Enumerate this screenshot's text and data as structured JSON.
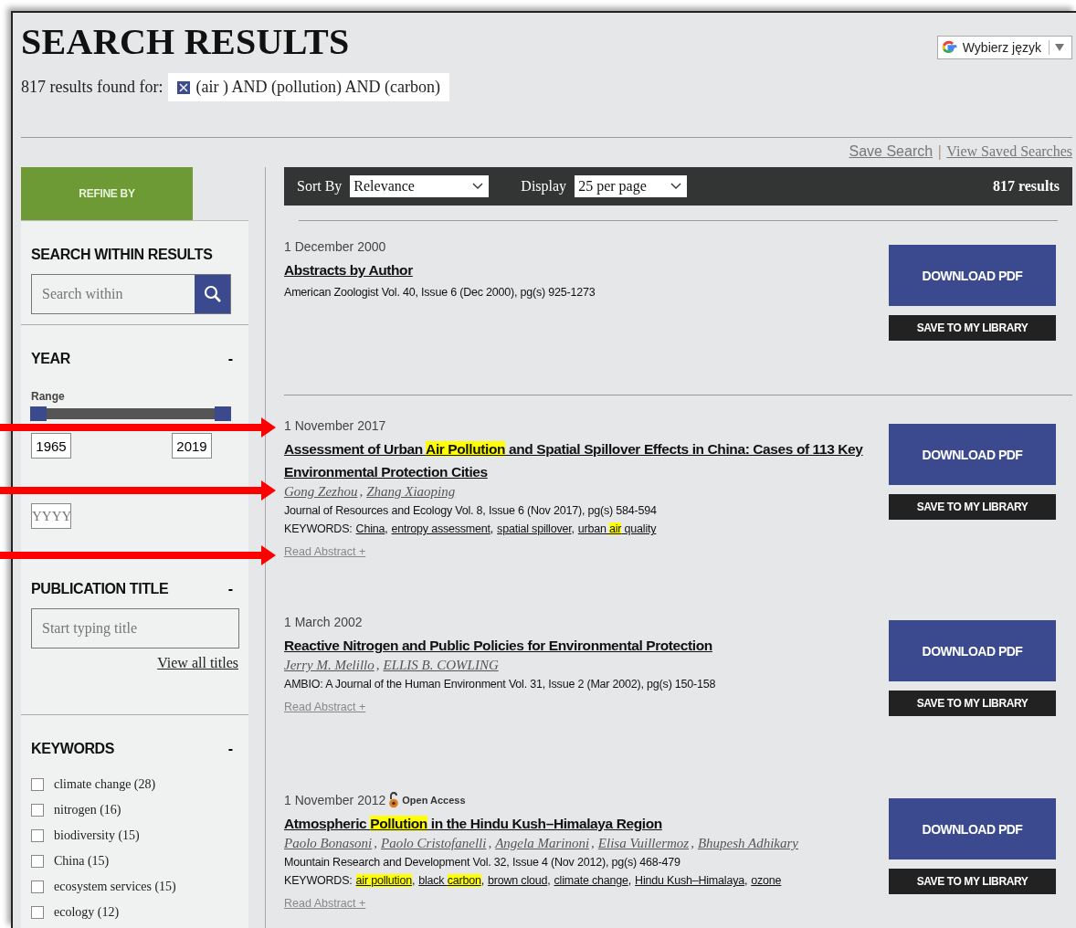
{
  "header": {
    "title": "SEARCH RESULTS",
    "results_label": "817 results found for:",
    "query": "(air ) AND (pollution) AND (carbon)"
  },
  "language": {
    "label": "Wybierz język"
  },
  "saved": {
    "save": "Save Search",
    "separator": "|",
    "view": "View Saved Searches"
  },
  "sidebar": {
    "refine": "REFINE BY",
    "search_within": {
      "heading": "SEARCH WITHIN RESULTS",
      "placeholder": "Search within"
    },
    "year": {
      "heading": "YEAR",
      "toggle": "-",
      "range_label": "Range",
      "from": "1965",
      "to": "2019",
      "single_placeholder": "YYYY"
    },
    "publication": {
      "heading": "PUBLICATION TITLE",
      "toggle": "-",
      "placeholder": "Start typing title",
      "link": "View all titles"
    },
    "keywords": {
      "heading": "KEYWORDS",
      "toggle": "-",
      "items": [
        {
          "label": "climate change (28)",
          "checked": false
        },
        {
          "label": "nitrogen (16)",
          "checked": false
        },
        {
          "label": "biodiversity (15)",
          "checked": false
        },
        {
          "label": "China (15)",
          "checked": false
        },
        {
          "label": "ecosystem services (15)",
          "checked": false
        },
        {
          "label": "ecology (12)",
          "checked": false
        }
      ]
    }
  },
  "toolbar": {
    "sort_label": "Sort By",
    "sort_value": "Relevance",
    "display_label": "Display",
    "display_value": "25 per page",
    "count": "817 results"
  },
  "separators": {
    "author": ",",
    "keyword": ","
  },
  "results": [
    {
      "date": "1 December 2000",
      "open_access": false,
      "title": [
        {
          "text": "Abstracts by Author",
          "highlight": false
        }
      ],
      "source": "American Zoologist Vol. 40, Issue 6 (Dec 2000), pg(s) 925-1273",
      "download": "DOWNLOAD PDF",
      "save": "SAVE TO MY LIBRARY"
    },
    {
      "date": "1 November 2017",
      "open_access": false,
      "title": [
        {
          "text": "Assessment of Urban ",
          "highlight": false
        },
        {
          "text": "Air Pollution",
          "highlight": true
        },
        {
          "text": " and Spatial Spillover Effects in China: Cases of 113 Key Environmental Protection Cities",
          "highlight": false
        }
      ],
      "authors": [
        "Gong Zezhou",
        "Zhang Xiaoping"
      ],
      "source": "Journal of Resources and Ecology Vol. 8, Issue 6 (Nov 2017), pg(s) 584-594",
      "keywords_label": "KEYWORDS:",
      "keywords": [
        [
          {
            "text": "China",
            "highlight": false
          }
        ],
        [
          {
            "text": "entropy assessment",
            "highlight": false
          }
        ],
        [
          {
            "text": "spatial spillover",
            "highlight": false
          }
        ],
        [
          {
            "text": "urban ",
            "highlight": false
          },
          {
            "text": "air",
            "highlight": true
          },
          {
            "text": " quality",
            "highlight": false
          }
        ]
      ],
      "read_abstract": "Read Abstract +",
      "download": "DOWNLOAD PDF",
      "save": "SAVE TO MY LIBRARY"
    },
    {
      "date": "1 March 2002",
      "open_access": false,
      "title": [
        {
          "text": "Reactive Nitrogen and Public Policies for Environmental Protection",
          "highlight": false
        }
      ],
      "authors": [
        "Jerry M. Melillo",
        "ELLIS B. COWLING"
      ],
      "source": "AMBIO: A Journal of the Human Environment Vol. 31, Issue 2 (Mar 2002), pg(s) 150-158",
      "read_abstract": "Read Abstract +",
      "download": "DOWNLOAD PDF",
      "save": "SAVE TO MY LIBRARY"
    },
    {
      "date": "1 November 2012",
      "open_access": true,
      "open_access_label": "Open Access",
      "title": [
        {
          "text": "Atmospheric ",
          "highlight": false
        },
        {
          "text": "Pollution",
          "highlight": true
        },
        {
          "text": " in the Hindu Kush–Himalaya Region",
          "highlight": false
        }
      ],
      "authors": [
        "Paolo Bonasoni",
        "Paolo Cristofanelli",
        "Angela Marinoni",
        "Elisa Vuillermoz",
        "Bhupesh Adhikary"
      ],
      "source": "Mountain Research and Development Vol. 32, Issue 4 (Nov 2012), pg(s) 468-479",
      "keywords_label": "KEYWORDS:",
      "keywords": [
        [
          {
            "text": "air pollution",
            "highlight": true
          }
        ],
        [
          {
            "text": "black ",
            "highlight": false
          },
          {
            "text": "carbon",
            "highlight": true
          }
        ],
        [
          {
            "text": "brown cloud",
            "highlight": false
          }
        ],
        [
          {
            "text": "climate change",
            "highlight": false
          }
        ],
        [
          {
            "text": "Hindu Kush–Himalaya",
            "highlight": false
          }
        ],
        [
          {
            "text": "ozone",
            "highlight": false
          }
        ]
      ],
      "read_abstract": "Read Abstract +",
      "download": "DOWNLOAD PDF",
      "save": "SAVE TO MY LIBRARY"
    }
  ]
}
